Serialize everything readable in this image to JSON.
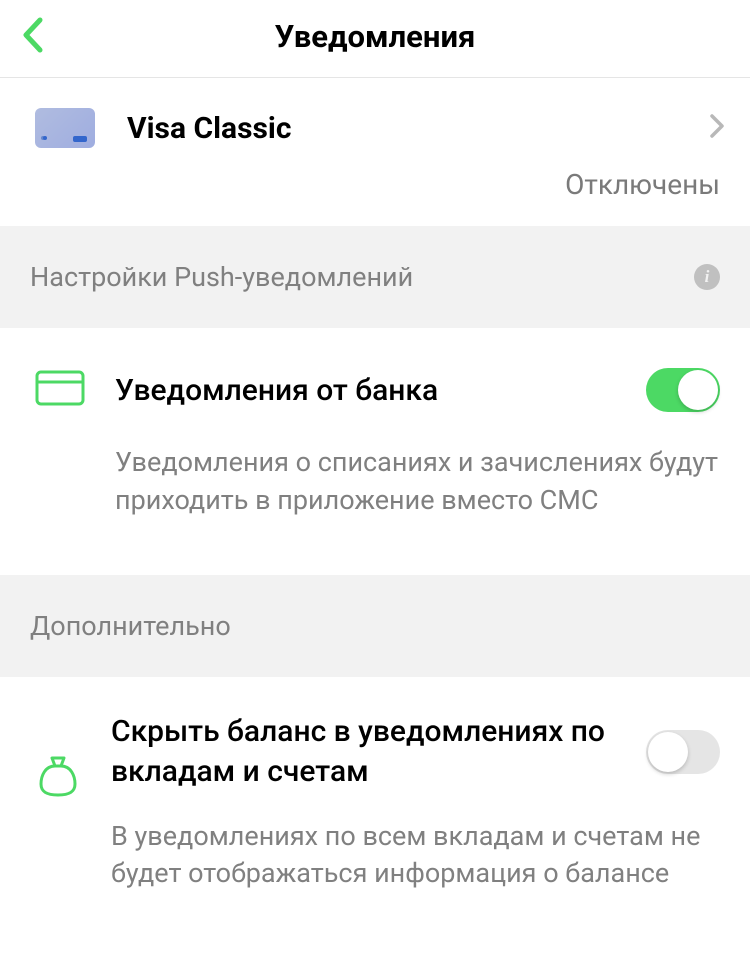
{
  "header": {
    "title": "Уведомления"
  },
  "card": {
    "name": "Visa Classic",
    "status": "Отключены"
  },
  "push_section": {
    "header": "Настройки Push-уведомлений",
    "bank_notifications": {
      "title": "Уведомления от банка",
      "description": "Уведомления о списаниях и зачислениях будут приходить в приложение вместо СМС",
      "enabled": true
    }
  },
  "additional_section": {
    "header": "Дополнительно",
    "hide_balance": {
      "title": "Скрыть баланс в уведомлениях по вкладам и счетам",
      "description": "В уведомлениях по всем вкладам и счетам не будет отображаться информация о балансе",
      "enabled": false
    }
  }
}
